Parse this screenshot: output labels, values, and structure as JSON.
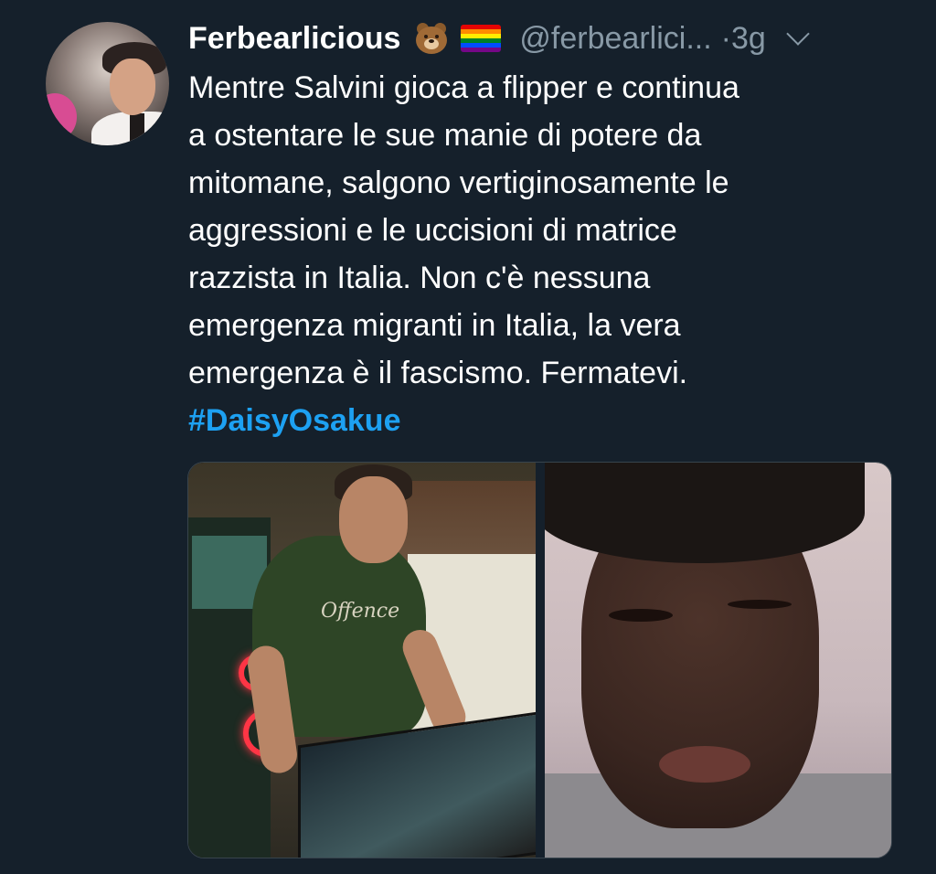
{
  "tweet": {
    "display_name": "Ferbearlicious",
    "handle": "@ferbearlici...",
    "separator": "·",
    "time": "3g",
    "emojis": [
      "bear-face-emoji",
      "rainbow-flag-emoji"
    ],
    "text_lines": [
      "Mentre Salvini gioca a flipper e continua",
      "a ostentare le sue manie di potere da",
      "mitomane, salgono vertiginosamente le",
      "aggressioni e le uccisioni di matrice",
      "razzista in Italia. Non c'è nessuna",
      "emergenza migranti in Italia, la vera",
      "emergenza è il fascismo. Fermatevi."
    ],
    "hashtag": "#DaisyOsakue",
    "media": {
      "count": 2,
      "left_shirt_text": "Offence"
    }
  },
  "colors": {
    "background": "#15202b",
    "text": "#ffffff",
    "secondary": "#8899a6",
    "link": "#1da1f2"
  }
}
